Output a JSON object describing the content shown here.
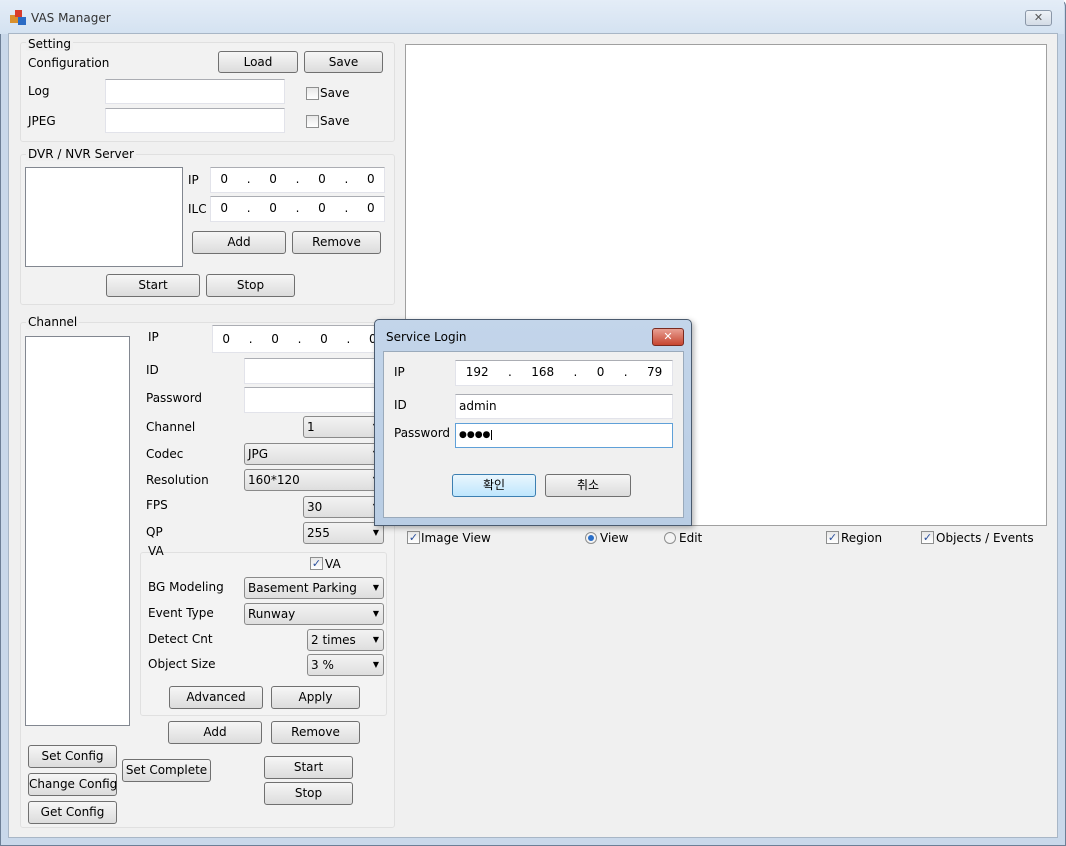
{
  "window": {
    "title": "VAS Manager",
    "close_icon": "close-icon"
  },
  "setting": {
    "group": "Setting",
    "configuration": "Configuration",
    "load": "Load",
    "save": "Save",
    "log": "Log",
    "jpeg": "JPEG",
    "log_save": "Save",
    "jpeg_save": "Save",
    "log_value": "",
    "jpeg_value": "",
    "log_save_checked": false,
    "jpeg_save_checked": false
  },
  "server": {
    "group": "DVR / NVR Server",
    "ip_label": "IP",
    "ilc_label": "ILC",
    "ip": [
      "0",
      "0",
      "0",
      "0"
    ],
    "ilc": [
      "0",
      "0",
      "0",
      "0"
    ],
    "add": "Add",
    "remove": "Remove",
    "start": "Start",
    "stop": "Stop"
  },
  "channel": {
    "group": "Channel",
    "ip_label": "IP",
    "ip": [
      "0",
      "0",
      "0",
      "0"
    ],
    "id_label": "ID",
    "password_label": "Password",
    "channel_label": "Channel",
    "channel": "1",
    "codec_label": "Codec",
    "codec": "JPG",
    "resolution_label": "Resolution",
    "resolution": "160*120",
    "fps_label": "FPS",
    "fps": "30",
    "qp_label": "QP",
    "qp": "255",
    "va": {
      "group": "VA",
      "va_check": "VA",
      "va_checked": true,
      "bg_label": "BG Modeling",
      "bg": "Basement Parking",
      "event_label": "Event Type",
      "event": "Runway",
      "detect_label": "Detect Cnt",
      "detect": "2 times",
      "size_label": "Object Size",
      "size": "3 %",
      "advanced": "Advanced",
      "apply": "Apply"
    },
    "add": "Add",
    "remove": "Remove",
    "set_config": "Set Config",
    "change_config": "Change Config",
    "get_config": "Get Config",
    "set_complete": "Set Complete",
    "start": "Start",
    "stop": "Stop"
  },
  "view": {
    "image_view": "Image View",
    "image_view_checked": true,
    "view": "View",
    "edit": "Edit",
    "mode": "View",
    "region": "Region",
    "region_checked": true,
    "objects": "Objects / Events",
    "objects_checked": true
  },
  "dialog": {
    "title": "Service Login",
    "ip_label": "IP",
    "ip": [
      "192",
      "168",
      "0",
      "79"
    ],
    "id_label": "ID",
    "id": "admin",
    "password_label": "Password",
    "password": "●●●●",
    "ok": "확인",
    "cancel": "취소"
  }
}
